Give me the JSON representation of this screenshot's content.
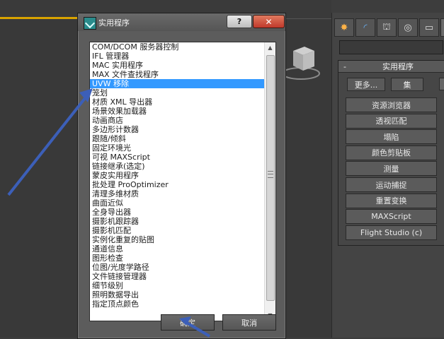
{
  "dialog": {
    "title": "实用程序",
    "help_label": "?",
    "close_label": "✕",
    "items": [
      "COM/DCOM 服务器控制",
      "IFL 管理器",
      "MAC 实用程序",
      "MAX 文件查找程序",
      "UVW 移除",
      "笼划",
      "材质 XML 导出器",
      "场景效果加载器",
      "动画商店",
      "多边形计数器",
      "跟随/倾斜",
      "固定环境光",
      "可视 MAXScript",
      "链接继承(选定)",
      "蒙皮实用程序",
      "批处理 ProOptimizer",
      "清理多维材质",
      "曲面近似",
      "全身导出器",
      "摄影机跟踪器",
      "摄影机匹配",
      "实例化重复的贴图",
      "通道信息",
      "图形检查",
      "位图/光度学路径",
      "文件链接管理器",
      "细节级别",
      "照明数据导出",
      "指定顶点颜色"
    ],
    "selected_index": 4,
    "ok_label": "确定",
    "cancel_label": "取消"
  },
  "command_panel": {
    "tabs": [
      "create-icon",
      "modify-icon",
      "hierarchy-icon",
      "motion-icon",
      "display-icon",
      "utilities-icon"
    ],
    "rollout": {
      "collapse_symbol": "-",
      "title": "实用程序",
      "more_label": "更多...",
      "sets_label": "集",
      "buttons": [
        "资源浏览器",
        "透视匹配",
        "塌陷",
        "颜色剪贴板",
        "测量",
        "运动捕捉",
        "重置变换",
        "MAXScript",
        "Flight Studio (c)"
      ]
    }
  }
}
